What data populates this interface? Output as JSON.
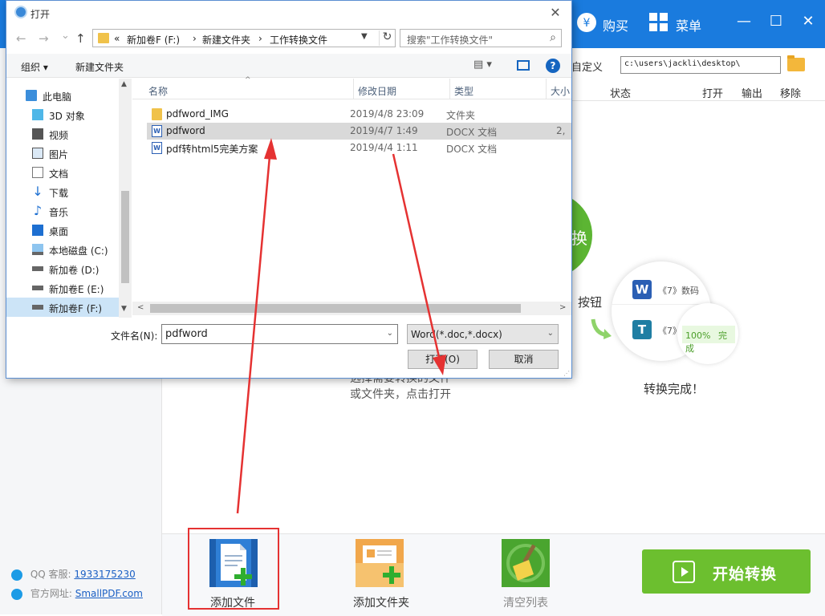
{
  "app": {
    "title_buttons": [
      {
        "icon": "yen-icon",
        "label": "购买"
      },
      {
        "icon": "menu-grid-icon",
        "label": "菜单"
      }
    ],
    "window_controls": {
      "minimize": "—",
      "maximize": "☐",
      "close": "✕"
    },
    "toolbar": {
      "custom_label": "自定义",
      "output_path": "c:\\users\\jackli\\desktop\\"
    },
    "columns": {
      "status": "状态",
      "open": "打开",
      "output": "输出",
      "remove": "移除"
    },
    "illustration": {
      "green_text": "换",
      "button_text": "按钮",
      "row1_text": "《7》数码",
      "row2_text": "《7》",
      "percent": "100%",
      "complete": "完成",
      "done_text": "转换完成！",
      "instruction_line1": "选择需要转换的文件",
      "instruction_line2": "或文件夹，点击打开"
    },
    "contact": {
      "qq_label": "QQ 客服:",
      "qq_value": "1933175230",
      "site_label": "官方网址:",
      "site_value": "SmallPDF.com"
    },
    "bottom": {
      "add_file": "添加文件",
      "add_folder": "添加文件夹",
      "clear_list": "清空列表",
      "start": "开始转换"
    },
    "colors": {
      "titlebar": "#1a7bde",
      "start_green": "#6cbf2f",
      "highlight_red": "#e53232"
    }
  },
  "dialog": {
    "title": "打开",
    "close": "✕",
    "nav": {
      "back": "←",
      "forward": "→",
      "dropdown": "⌄",
      "up": "↑"
    },
    "breadcrumb": [
      "«",
      "新加卷F (F:)",
      "›",
      "新建文件夹",
      "›",
      "工作转换文件"
    ],
    "search_placeholder": "搜索\"工作转换文件\"",
    "commands": {
      "organize": "组织 ▾",
      "new_folder": "新建文件夹",
      "view": "▤ ▾",
      "help": "?"
    },
    "nav_pane": [
      {
        "icon": "computer-icon",
        "label": "此电脑",
        "selected": false
      },
      {
        "icon": "cube-icon",
        "label": "3D 对象",
        "selected": false
      },
      {
        "icon": "video-icon",
        "label": "视频",
        "selected": false
      },
      {
        "icon": "picture-icon",
        "label": "图片",
        "selected": false
      },
      {
        "icon": "document-icon",
        "label": "文档",
        "selected": false
      },
      {
        "icon": "download-icon",
        "label": "下载",
        "selected": false
      },
      {
        "icon": "music-icon",
        "label": "音乐",
        "selected": false
      },
      {
        "icon": "desktop-icon",
        "label": "桌面",
        "selected": false
      },
      {
        "icon": "drive-c-icon",
        "label": "本地磁盘 (C:)",
        "selected": false
      },
      {
        "icon": "drive-icon",
        "label": "新加卷 (D:)",
        "selected": false
      },
      {
        "icon": "drive-icon",
        "label": "新加卷E (E:)",
        "selected": false
      },
      {
        "icon": "drive-icon",
        "label": "新加卷F (F:)",
        "selected": true
      }
    ],
    "file_columns": {
      "name": "名称",
      "date": "修改日期",
      "type": "类型",
      "size": "大小"
    },
    "files": [
      {
        "icon": "folder-icon",
        "name": "pdfword_IMG",
        "date": "2019/4/8 23:09",
        "type": "文件夹",
        "size": "",
        "selected": false
      },
      {
        "icon": "docx-icon",
        "name": "pdfword",
        "date": "2019/4/7 1:49",
        "type": "DOCX 文档",
        "size": "2,",
        "selected": true
      },
      {
        "icon": "docx-icon",
        "name": "pdf转html5完美方案",
        "date": "2019/4/4 1:11",
        "type": "DOCX 文档",
        "size": "",
        "selected": false
      }
    ],
    "filename_label": "文件名(N):",
    "filename_value": "pdfword",
    "filetype_value": "Word(*.doc,*.docx)",
    "open_label": "打开(O)",
    "cancel_label": "取消"
  }
}
